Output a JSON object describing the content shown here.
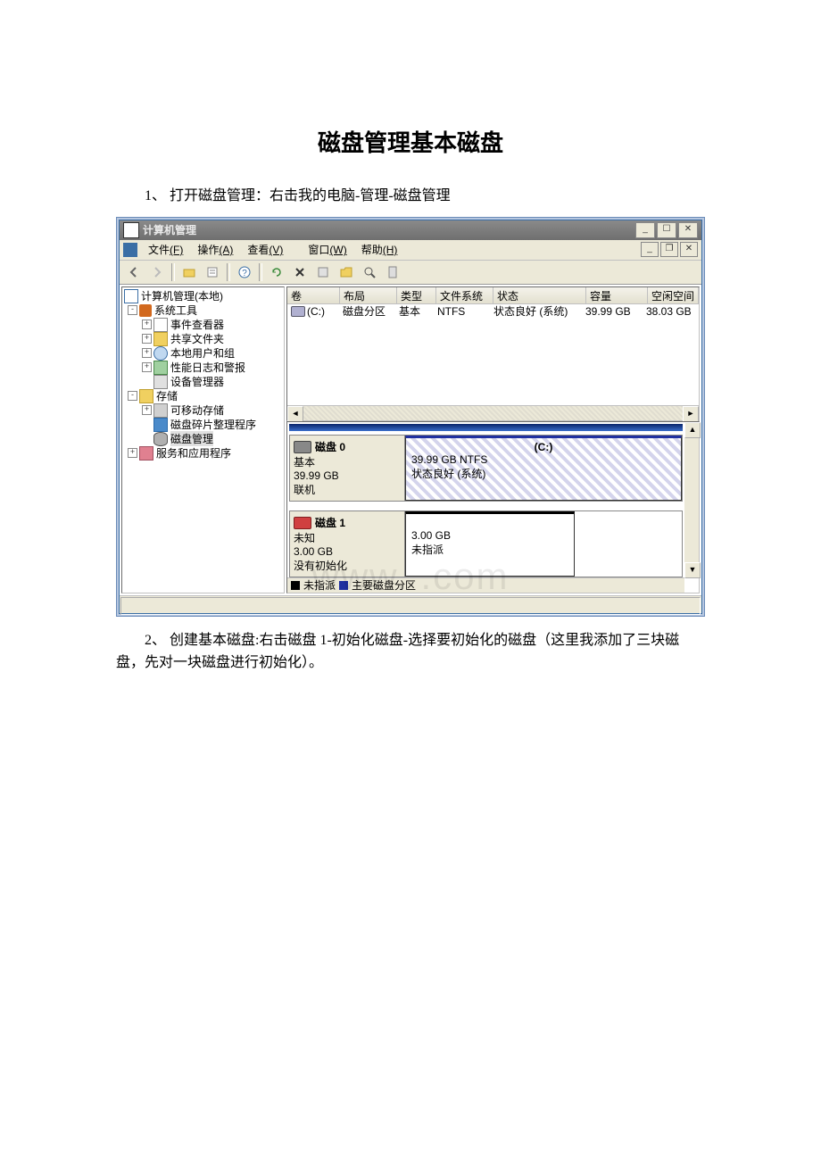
{
  "doc": {
    "title": "磁盘管理基本磁盘",
    "p1": "1、 打开磁盘管理：右击我的电脑-管理-磁盘管理",
    "p2": "2、 创建基本磁盘:右击磁盘 1-初始化磁盘-选择要初始化的磁盘（这里我添加了三块磁盘，先对一块磁盘进行初始化）。",
    "watermark": "www.                  .com"
  },
  "win": {
    "title": "计算机管理",
    "menu": {
      "file": "文件",
      "file_m": "(F)",
      "action": "操作",
      "action_m": "(A)",
      "view": "查看",
      "view_m": "(V)",
      "window": "窗口",
      "window_m": "(W)",
      "help": "帮助",
      "help_m": "(H)"
    },
    "tree": {
      "root": "计算机管理(本地)",
      "systools": "系统工具",
      "event": "事件查看器",
      "shared": "共享文件夹",
      "users": "本地用户和组",
      "perf": "性能日志和警报",
      "device": "设备管理器",
      "storage": "存储",
      "removable": "可移动存储",
      "defrag": "磁盘碎片整理程序",
      "diskmgmt": "磁盘管理",
      "services": "服务和应用程序"
    },
    "cols": {
      "vol": "卷",
      "layout": "布局",
      "type": "类型",
      "fs": "文件系统",
      "status": "状态",
      "capacity": "容量",
      "free": "空闲空间"
    },
    "volrow": {
      "name": "(C:)",
      "layout": "磁盘分区",
      "type": "基本",
      "fs": "NTFS",
      "status": "状态良好 (系统)",
      "capacity": "39.99 GB",
      "free": "38.03 GB"
    },
    "disk0": {
      "title": "磁盘 0",
      "type": "基本",
      "size": "39.99 GB",
      "state": "联机",
      "part_name": "(C:)",
      "part_info": "39.99 GB NTFS",
      "part_status": "状态良好 (系统)"
    },
    "disk1": {
      "title": "磁盘 1",
      "type": "未知",
      "size": "3.00 GB",
      "state": "没有初始化",
      "part_info": "3.00 GB",
      "part_status": "未指派"
    },
    "legend": {
      "unalloc": "未指派",
      "primary": "主要磁盘分区"
    }
  }
}
